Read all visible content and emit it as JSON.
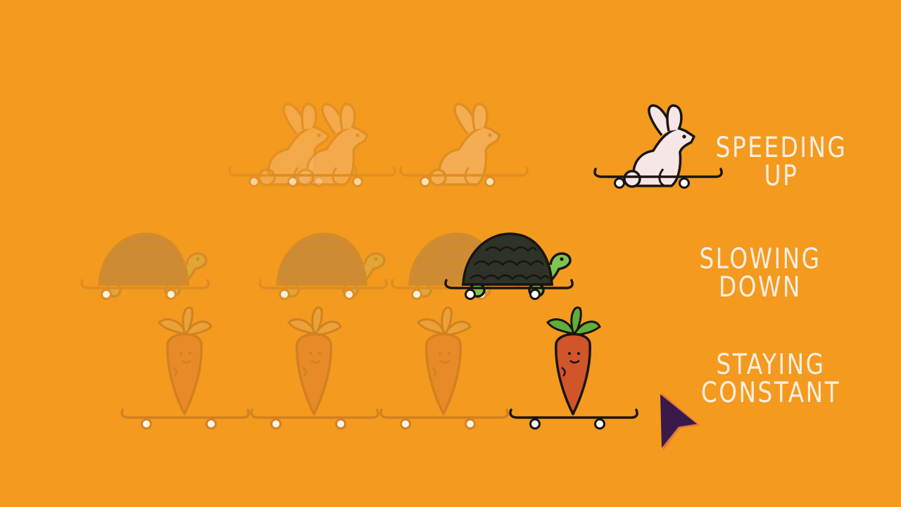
{
  "colors": {
    "background": "#f39a1f",
    "label_text": "#fbeee0",
    "outline": "#1a1410",
    "rabbit_body": "#f7e6e6",
    "turtle_shell": "#2e3328",
    "turtle_skin": "#7ec453",
    "carrot_body": "#d2542b",
    "carrot_leaves": "#5fae3a",
    "ghost_fill": "#f6b66a",
    "ghost_line": "#d98a24",
    "arrow_fill": "#3a1a4a",
    "arrow_edge": "#e0773a"
  },
  "rows": {
    "speeding": {
      "line1": "SPEEDING",
      "line2": "UP"
    },
    "slowing": {
      "line1": "SLOWING",
      "line2": "DOWN"
    },
    "constant": {
      "line1": "STAYING",
      "line2": "CONSTANT"
    }
  },
  "icons": {
    "rabbit": "rabbit-on-skateboard-icon",
    "turtle": "turtle-on-skateboard-icon",
    "carrot": "carrot-on-skateboard-icon",
    "pointer": "play-cursor-icon"
  }
}
